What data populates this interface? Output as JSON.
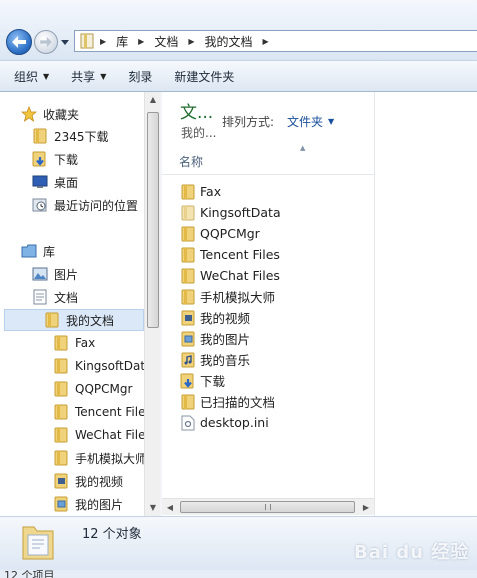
{
  "address": {
    "crumbs": [
      "库",
      "文档",
      "我的文档"
    ]
  },
  "toolbar": {
    "organize": "组织",
    "share": "共享",
    "burn": "刻录",
    "new_folder": "新建文件夹"
  },
  "nav": {
    "favorites_label": "收藏夹",
    "favorites": [
      "2345下载",
      "下载",
      "桌面",
      "最近访问的位置"
    ],
    "libraries_label": "库",
    "libraries": [
      "图片",
      "文档"
    ],
    "selected_folder": "我的文档",
    "children": [
      "Fax",
      "KingsoftDat",
      "QQPCMgr",
      "Tencent File",
      "WeChat File",
      "手机模拟大师",
      "我的视频",
      "我的图片"
    ]
  },
  "content": {
    "library_title": "文...",
    "library_subtitle": "我的...",
    "arrange_label": "排列方式:",
    "arrange_value": "文件夹",
    "column_name": "名称",
    "files": [
      {
        "name": "Fax",
        "icon": "folder-icon"
      },
      {
        "name": "KingsoftData",
        "icon": "folder-icon"
      },
      {
        "name": "QQPCMgr",
        "icon": "folder-icon"
      },
      {
        "name": "Tencent Files",
        "icon": "folder-icon"
      },
      {
        "name": "WeChat Files",
        "icon": "folder-icon"
      },
      {
        "name": "手机模拟大师",
        "icon": "folder-icon"
      },
      {
        "name": "我的视频",
        "icon": "videos-folder-icon"
      },
      {
        "name": "我的图片",
        "icon": "pictures-folder-icon"
      },
      {
        "name": "我的音乐",
        "icon": "music-folder-icon"
      },
      {
        "name": "下载",
        "icon": "downloads-folder-icon"
      },
      {
        "name": "已扫描的文档",
        "icon": "folder-icon"
      },
      {
        "name": "desktop.ini",
        "icon": "settings-file-icon"
      }
    ]
  },
  "details": {
    "item_count": "12 个对象"
  },
  "status": {
    "text": "12 个项目"
  },
  "watermark": "Bai du 经验",
  "colors": {
    "library_title": "#1f6b2e",
    "link_blue": "#1a4f9c",
    "folder_yellow": "#e9c45a"
  }
}
